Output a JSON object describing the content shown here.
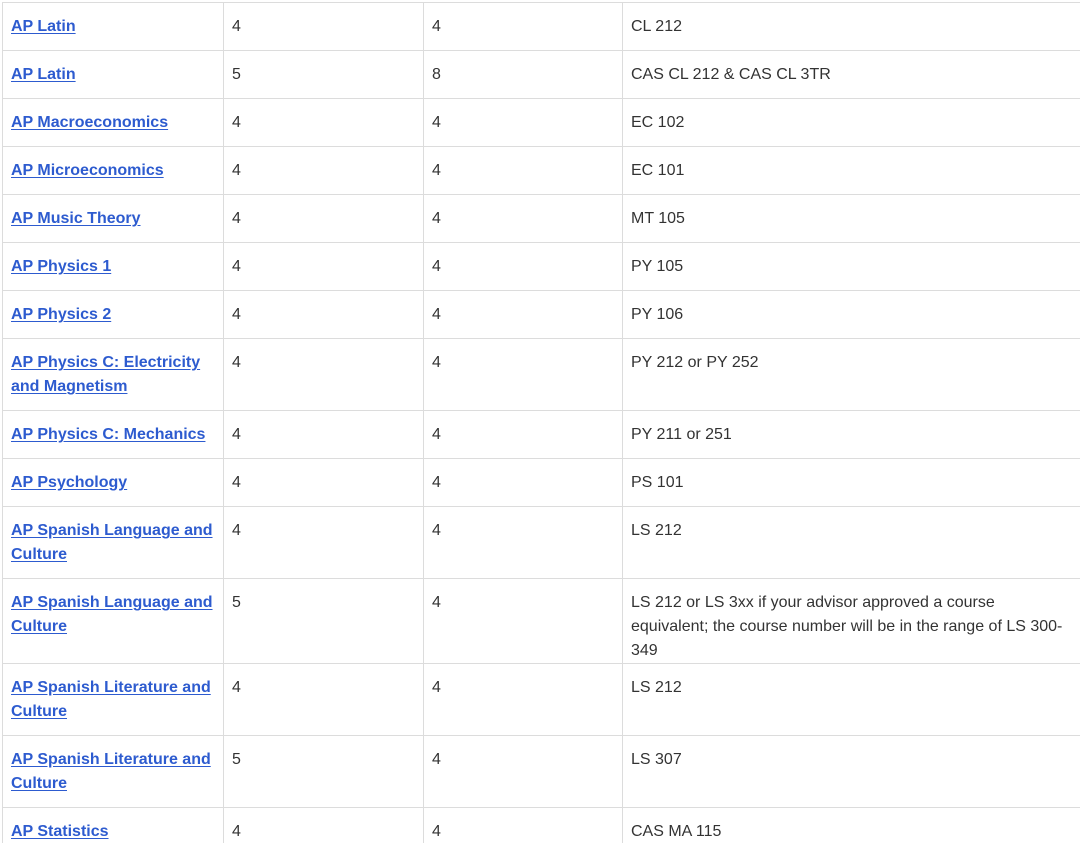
{
  "rows": [
    {
      "exam": "AP Latin",
      "score": "4",
      "credits": "4",
      "equivalent": "CL 212"
    },
    {
      "exam": "AP Latin",
      "score": "5",
      "credits": "8",
      "equivalent": "CAS CL 212 & CAS CL 3TR"
    },
    {
      "exam": "AP Macroeconomics",
      "score": "4",
      "credits": "4",
      "equivalent": "EC 102"
    },
    {
      "exam": "AP Microeconomics",
      "score": "4",
      "credits": "4",
      "equivalent": "EC 101"
    },
    {
      "exam": "AP Music Theory",
      "score": "4",
      "credits": "4",
      "equivalent": "MT 105"
    },
    {
      "exam": "AP Physics 1",
      "score": "4",
      "credits": "4",
      "equivalent": "PY 105"
    },
    {
      "exam": "AP Physics 2",
      "score": "4",
      "credits": "4",
      "equivalent": "PY 106"
    },
    {
      "exam": "AP Physics C: Electricity and Magnetism",
      "score": "4",
      "credits": "4",
      "equivalent": "PY 212 or PY 252"
    },
    {
      "exam": "AP Physics C: Mechanics",
      "score": "4",
      "credits": "4",
      "equivalent": "PY 211 or 251"
    },
    {
      "exam": "AP Psychology",
      "score": "4",
      "credits": "4",
      "equivalent": "PS 101"
    },
    {
      "exam": "AP Spanish Language and Culture",
      "score": "4",
      "credits": "4",
      "equivalent": "LS 212"
    },
    {
      "exam": "AP Spanish Language and Culture",
      "score": "5",
      "credits": "4",
      "equivalent": "LS 212 or LS 3xx if your advisor approved a course equivalent; the course number will be in the range of LS 300-349"
    },
    {
      "exam": "AP Spanish Literature and Culture",
      "score": "4",
      "credits": "4",
      "equivalent": "LS 212"
    },
    {
      "exam": "AP Spanish Literature and Culture",
      "score": "5",
      "credits": "4",
      "equivalent": "LS 307"
    },
    {
      "exam": "AP Statistics",
      "score": "4",
      "credits": "4",
      "equivalent": "CAS MA 115"
    }
  ],
  "colors": {
    "link": "#2d5bcf",
    "text": "#333333",
    "border": "#dcdcdc",
    "background": "#ffffff"
  }
}
